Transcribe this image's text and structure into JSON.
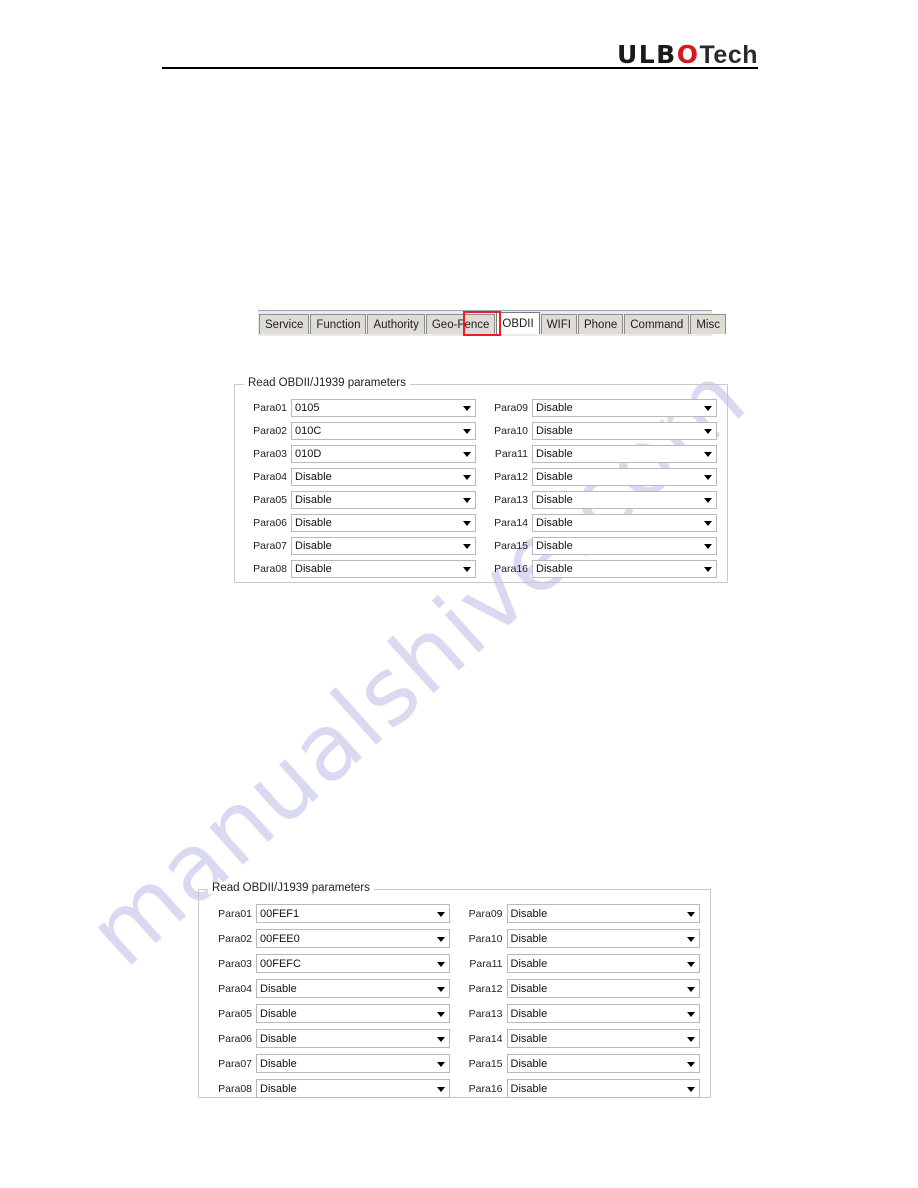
{
  "header": {
    "logo_primary": "ULB",
    "logo_accent_letter": "O",
    "logo_secondary": "Tech",
    "accent_color": "#d4191f"
  },
  "watermark": {
    "text": "manualshive.com",
    "color": "#d9d9f2"
  },
  "tabbar": {
    "tabs": [
      {
        "label": "Service",
        "active": false
      },
      {
        "label": "Function",
        "active": false
      },
      {
        "label": "Authority",
        "active": false
      },
      {
        "label": "Geo-Fence",
        "active": false
      },
      {
        "label": "OBDII",
        "active": true
      },
      {
        "label": "WIFI",
        "active": false
      },
      {
        "label": "Phone",
        "active": false
      },
      {
        "label": "Command",
        "active": false
      },
      {
        "label": "Misc",
        "active": false
      }
    ],
    "highlighted_tab": "OBDII",
    "highlight_color": "#ee1c24"
  },
  "panel_top": {
    "legend": "Read OBDII/J1939 parameters",
    "left_column": [
      {
        "label": "Para01",
        "value": "0105"
      },
      {
        "label": "Para02",
        "value": "010C"
      },
      {
        "label": "Para03",
        "value": "010D"
      },
      {
        "label": "Para04",
        "value": "Disable"
      },
      {
        "label": "Para05",
        "value": "Disable"
      },
      {
        "label": "Para06",
        "value": "Disable"
      },
      {
        "label": "Para07",
        "value": "Disable"
      },
      {
        "label": "Para08",
        "value": "Disable"
      }
    ],
    "right_column": [
      {
        "label": "Para09",
        "value": "Disable"
      },
      {
        "label": "Para10",
        "value": "Disable"
      },
      {
        "label": "Para11",
        "value": "Disable"
      },
      {
        "label": "Para12",
        "value": "Disable"
      },
      {
        "label": "Para13",
        "value": "Disable"
      },
      {
        "label": "Para14",
        "value": "Disable"
      },
      {
        "label": "Para15",
        "value": "Disable"
      },
      {
        "label": "Para16",
        "value": "Disable"
      }
    ]
  },
  "panel_bottom": {
    "legend": "Read OBDII/J1939 parameters",
    "left_column": [
      {
        "label": "Para01",
        "value": "00FEF1"
      },
      {
        "label": "Para02",
        "value": "00FEE0"
      },
      {
        "label": "Para03",
        "value": "00FEFC"
      },
      {
        "label": "Para04",
        "value": "Disable"
      },
      {
        "label": "Para05",
        "value": "Disable"
      },
      {
        "label": "Para06",
        "value": "Disable"
      },
      {
        "label": "Para07",
        "value": "Disable"
      },
      {
        "label": "Para08",
        "value": "Disable"
      }
    ],
    "right_column": [
      {
        "label": "Para09",
        "value": "Disable"
      },
      {
        "label": "Para10",
        "value": "Disable"
      },
      {
        "label": "Para11",
        "value": "Disable"
      },
      {
        "label": "Para12",
        "value": "Disable"
      },
      {
        "label": "Para13",
        "value": "Disable"
      },
      {
        "label": "Para14",
        "value": "Disable"
      },
      {
        "label": "Para15",
        "value": "Disable"
      },
      {
        "label": "Para16",
        "value": "Disable"
      }
    ]
  }
}
